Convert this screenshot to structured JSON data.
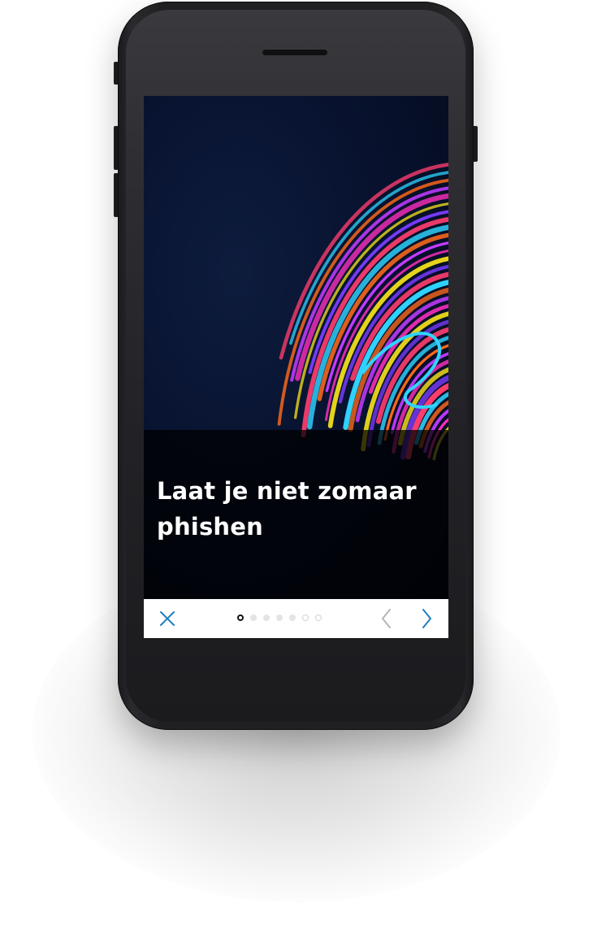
{
  "slide": {
    "headline": "Laat je niet zomaar phishen",
    "image_subject": "fingerprint-illustration"
  },
  "pagination": {
    "total": 7,
    "current": 1,
    "dots": [
      {
        "state": "active"
      },
      {
        "state": "filled"
      },
      {
        "state": "filled"
      },
      {
        "state": "filled"
      },
      {
        "state": "filled"
      },
      {
        "state": "hollow"
      },
      {
        "state": "hollow"
      }
    ]
  },
  "navigation": {
    "close_icon": "close-icon",
    "prev_icon": "chevron-left-icon",
    "next_icon": "chevron-right-icon"
  },
  "colors": {
    "accent": "#1e7fc2",
    "disabled": "#b5b5b5",
    "background_dark": "#061029",
    "caption_overlay": "#000000",
    "fingerprint_palette": [
      "#f5e21a",
      "#ff2fbf",
      "#c23bff",
      "#ff6a1a",
      "#2fd4ff",
      "#ff3d6e",
      "#7a3cff"
    ]
  }
}
